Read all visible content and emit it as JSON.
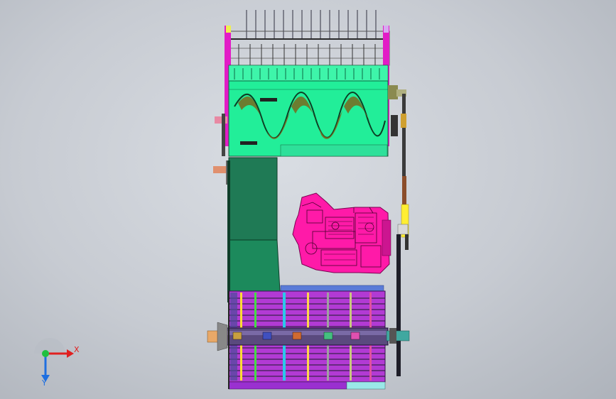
{
  "triad": {
    "x_label": "X",
    "y_label": "Y"
  },
  "colors": {
    "header_green": "#22ee99",
    "feeder_green": "#1f7a55",
    "engine_magenta": "#ff1aa8",
    "thresher_purple": "#9a2bd8",
    "drive_yellow": "#ffee33",
    "axis_x": "#e02020",
    "axis_y": "#1f6fe0",
    "origin": "#20c040"
  }
}
